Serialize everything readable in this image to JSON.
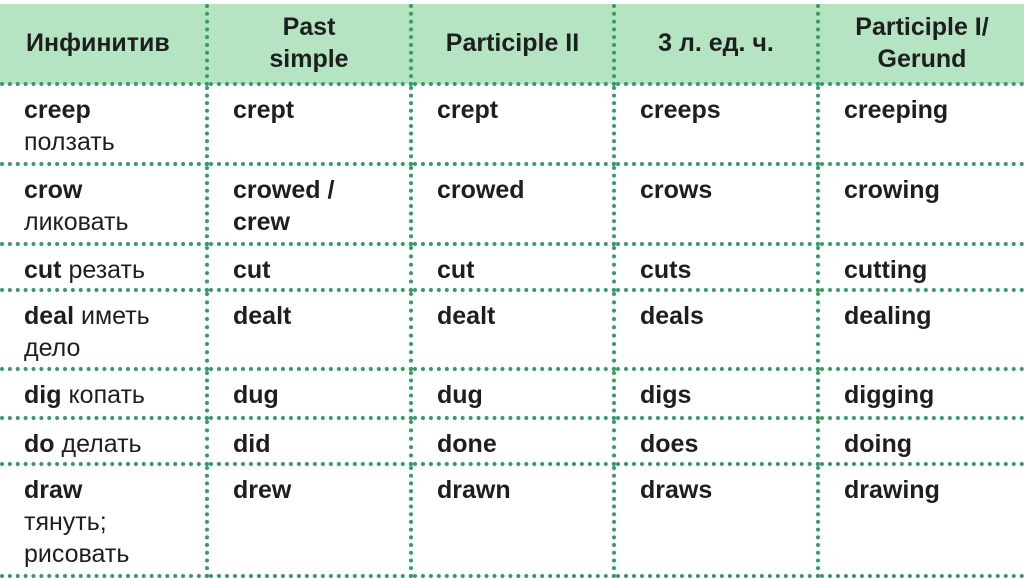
{
  "headers": [
    "Инфинитив",
    "Past simple",
    "Participle II",
    "3 л. ед. ч.",
    "Participle I/ Gerund"
  ],
  "rows": [
    {
      "infinitive": "creep",
      "translation": "ползать",
      "past": "crept",
      "p2": "crept",
      "third": "creeps",
      "p1": "creeping"
    },
    {
      "infinitive": "crow",
      "translation": "ликовать",
      "past": "crowed / crew",
      "p2": "crowed",
      "third": "crows",
      "p1": "crowing"
    },
    {
      "infinitive": "cut",
      "translation": "резать",
      "past": "cut",
      "p2": "cut",
      "third": "cuts",
      "p1": "cutting"
    },
    {
      "infinitive": "deal",
      "translation": "иметь дело",
      "past": "dealt",
      "p2": "dealt",
      "third": "deals",
      "p1": "dealing"
    },
    {
      "infinitive": "dig",
      "translation": "копать",
      "past": "dug",
      "p2": "dug",
      "third": "digs",
      "p1": "digging"
    },
    {
      "infinitive": "do",
      "translation": "делать",
      "past": "did",
      "p2": "done",
      "third": "does",
      "p1": "doing"
    },
    {
      "infinitive": "draw",
      "translation": "тянуть; рисовать",
      "past": "drew",
      "p2": "drawn",
      "third": "draws",
      "p1": "drawing"
    }
  ],
  "colors": {
    "header_bg": "#b5e4c3",
    "border": "#2f9f62"
  }
}
